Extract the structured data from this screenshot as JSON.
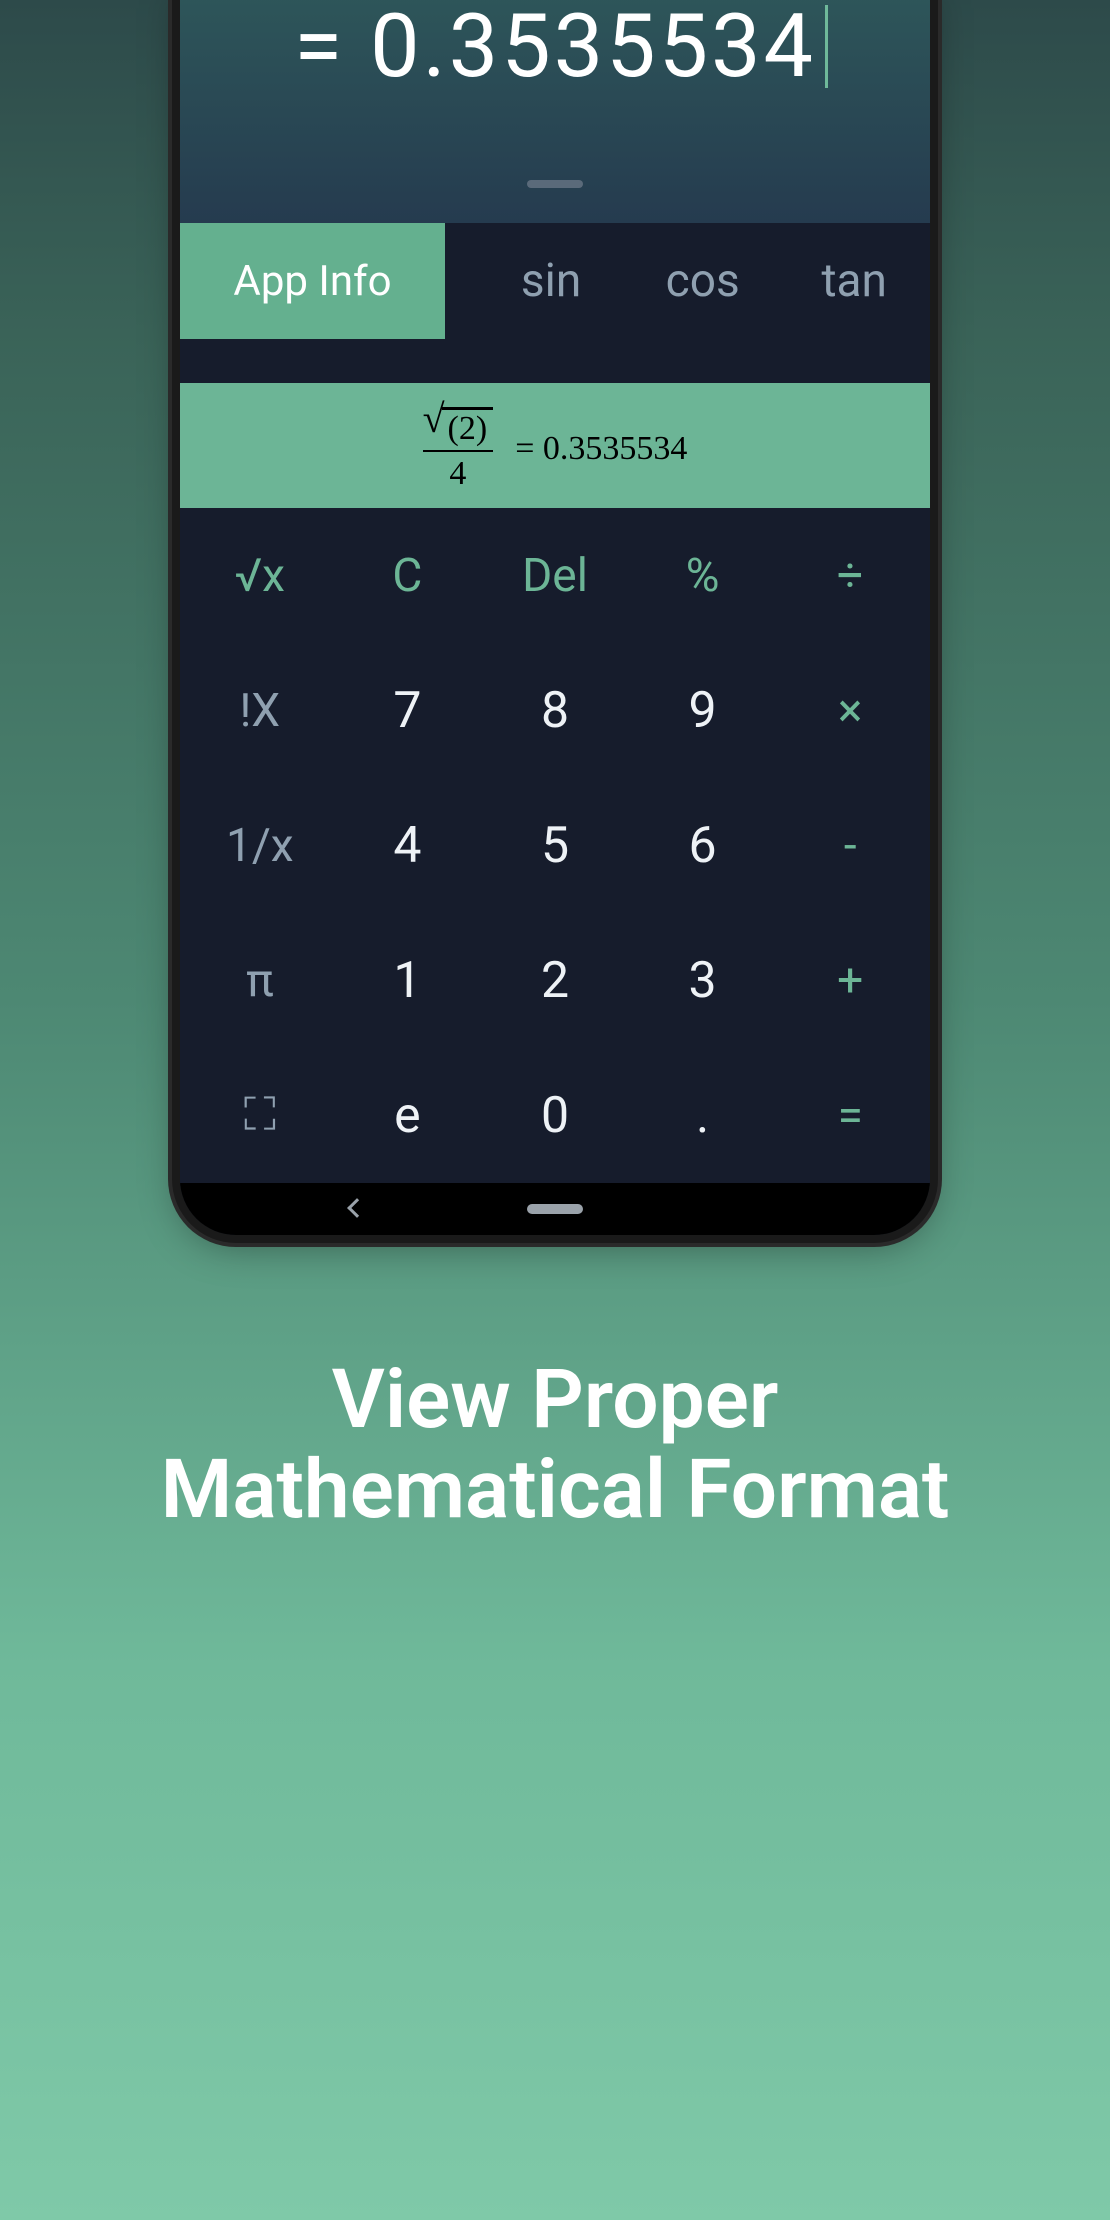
{
  "display": {
    "result": "= 0.3535534"
  },
  "toolbar": {
    "app_info": "App Info",
    "sin": "sin",
    "cos": "cos",
    "tan": "tan"
  },
  "formula": {
    "radicand": "(2)",
    "denominator": "4",
    "rhs": "= 0.3535534"
  },
  "keys": {
    "sqrt": "√x",
    "clear": "C",
    "del": "Del",
    "percent": "%",
    "divide": "÷",
    "fact": "!X",
    "seven": "7",
    "eight": "8",
    "nine": "9",
    "multiply": "×",
    "inverse": "1/x",
    "four": "4",
    "five": "5",
    "six": "6",
    "minus": "-",
    "pi": "π",
    "one": "1",
    "two": "2",
    "three": "3",
    "plus": "+",
    "expand": "⛶",
    "e": "e",
    "zero": "0",
    "dot": ".",
    "equals": "="
  },
  "caption": {
    "line1": "View Proper",
    "line2": "Mathematical Format"
  }
}
